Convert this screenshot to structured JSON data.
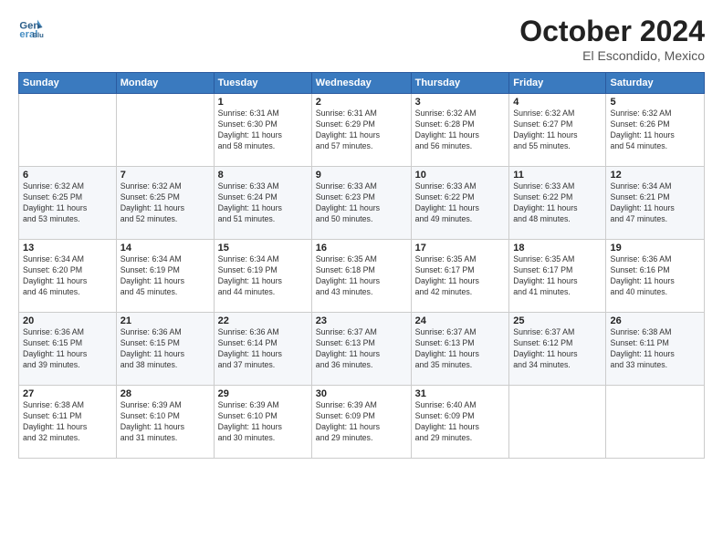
{
  "header": {
    "logo_line1": "General",
    "logo_line2": "Blue",
    "month_year": "October 2024",
    "location": "El Escondido, Mexico"
  },
  "days_of_week": [
    "Sunday",
    "Monday",
    "Tuesday",
    "Wednesday",
    "Thursday",
    "Friday",
    "Saturday"
  ],
  "weeks": [
    [
      {
        "day": "",
        "info": ""
      },
      {
        "day": "",
        "info": ""
      },
      {
        "day": "1",
        "info": "Sunrise: 6:31 AM\nSunset: 6:30 PM\nDaylight: 11 hours\nand 58 minutes."
      },
      {
        "day": "2",
        "info": "Sunrise: 6:31 AM\nSunset: 6:29 PM\nDaylight: 11 hours\nand 57 minutes."
      },
      {
        "day": "3",
        "info": "Sunrise: 6:32 AM\nSunset: 6:28 PM\nDaylight: 11 hours\nand 56 minutes."
      },
      {
        "day": "4",
        "info": "Sunrise: 6:32 AM\nSunset: 6:27 PM\nDaylight: 11 hours\nand 55 minutes."
      },
      {
        "day": "5",
        "info": "Sunrise: 6:32 AM\nSunset: 6:26 PM\nDaylight: 11 hours\nand 54 minutes."
      }
    ],
    [
      {
        "day": "6",
        "info": "Sunrise: 6:32 AM\nSunset: 6:25 PM\nDaylight: 11 hours\nand 53 minutes."
      },
      {
        "day": "7",
        "info": "Sunrise: 6:32 AM\nSunset: 6:25 PM\nDaylight: 11 hours\nand 52 minutes."
      },
      {
        "day": "8",
        "info": "Sunrise: 6:33 AM\nSunset: 6:24 PM\nDaylight: 11 hours\nand 51 minutes."
      },
      {
        "day": "9",
        "info": "Sunrise: 6:33 AM\nSunset: 6:23 PM\nDaylight: 11 hours\nand 50 minutes."
      },
      {
        "day": "10",
        "info": "Sunrise: 6:33 AM\nSunset: 6:22 PM\nDaylight: 11 hours\nand 49 minutes."
      },
      {
        "day": "11",
        "info": "Sunrise: 6:33 AM\nSunset: 6:22 PM\nDaylight: 11 hours\nand 48 minutes."
      },
      {
        "day": "12",
        "info": "Sunrise: 6:34 AM\nSunset: 6:21 PM\nDaylight: 11 hours\nand 47 minutes."
      }
    ],
    [
      {
        "day": "13",
        "info": "Sunrise: 6:34 AM\nSunset: 6:20 PM\nDaylight: 11 hours\nand 46 minutes."
      },
      {
        "day": "14",
        "info": "Sunrise: 6:34 AM\nSunset: 6:19 PM\nDaylight: 11 hours\nand 45 minutes."
      },
      {
        "day": "15",
        "info": "Sunrise: 6:34 AM\nSunset: 6:19 PM\nDaylight: 11 hours\nand 44 minutes."
      },
      {
        "day": "16",
        "info": "Sunrise: 6:35 AM\nSunset: 6:18 PM\nDaylight: 11 hours\nand 43 minutes."
      },
      {
        "day": "17",
        "info": "Sunrise: 6:35 AM\nSunset: 6:17 PM\nDaylight: 11 hours\nand 42 minutes."
      },
      {
        "day": "18",
        "info": "Sunrise: 6:35 AM\nSunset: 6:17 PM\nDaylight: 11 hours\nand 41 minutes."
      },
      {
        "day": "19",
        "info": "Sunrise: 6:36 AM\nSunset: 6:16 PM\nDaylight: 11 hours\nand 40 minutes."
      }
    ],
    [
      {
        "day": "20",
        "info": "Sunrise: 6:36 AM\nSunset: 6:15 PM\nDaylight: 11 hours\nand 39 minutes."
      },
      {
        "day": "21",
        "info": "Sunrise: 6:36 AM\nSunset: 6:15 PM\nDaylight: 11 hours\nand 38 minutes."
      },
      {
        "day": "22",
        "info": "Sunrise: 6:36 AM\nSunset: 6:14 PM\nDaylight: 11 hours\nand 37 minutes."
      },
      {
        "day": "23",
        "info": "Sunrise: 6:37 AM\nSunset: 6:13 PM\nDaylight: 11 hours\nand 36 minutes."
      },
      {
        "day": "24",
        "info": "Sunrise: 6:37 AM\nSunset: 6:13 PM\nDaylight: 11 hours\nand 35 minutes."
      },
      {
        "day": "25",
        "info": "Sunrise: 6:37 AM\nSunset: 6:12 PM\nDaylight: 11 hours\nand 34 minutes."
      },
      {
        "day": "26",
        "info": "Sunrise: 6:38 AM\nSunset: 6:11 PM\nDaylight: 11 hours\nand 33 minutes."
      }
    ],
    [
      {
        "day": "27",
        "info": "Sunrise: 6:38 AM\nSunset: 6:11 PM\nDaylight: 11 hours\nand 32 minutes."
      },
      {
        "day": "28",
        "info": "Sunrise: 6:39 AM\nSunset: 6:10 PM\nDaylight: 11 hours\nand 31 minutes."
      },
      {
        "day": "29",
        "info": "Sunrise: 6:39 AM\nSunset: 6:10 PM\nDaylight: 11 hours\nand 30 minutes."
      },
      {
        "day": "30",
        "info": "Sunrise: 6:39 AM\nSunset: 6:09 PM\nDaylight: 11 hours\nand 29 minutes."
      },
      {
        "day": "31",
        "info": "Sunrise: 6:40 AM\nSunset: 6:09 PM\nDaylight: 11 hours\nand 29 minutes."
      },
      {
        "day": "",
        "info": ""
      },
      {
        "day": "",
        "info": ""
      }
    ]
  ]
}
